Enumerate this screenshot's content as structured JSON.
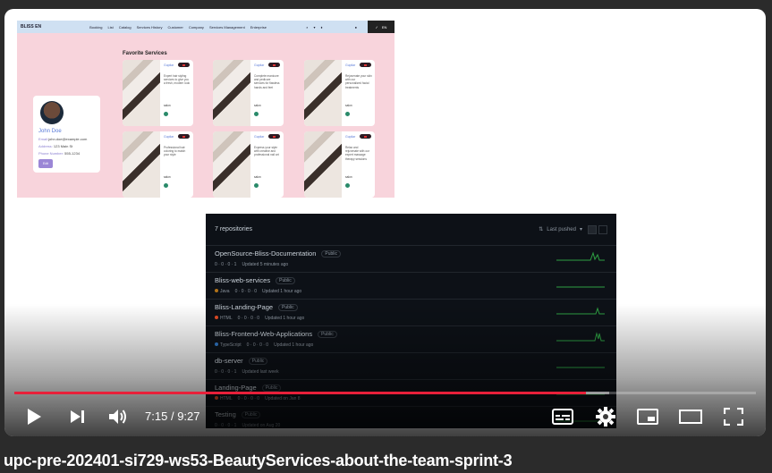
{
  "video": {
    "title": "upc-pre-202401-si729-ws53-BeautyServices-about-the-team-sprint-3",
    "current_time": "7:15",
    "separator": "/",
    "duration": "9:27",
    "progress_fraction": 0.771,
    "buffered_fraction": 0.802,
    "accent_color": "#e8203a"
  },
  "controls": {
    "play": "play-icon",
    "next": "next-icon",
    "volume": "volume-icon",
    "subtitles": "subtitles-icon",
    "settings": "gear-icon",
    "miniplayer": "miniplayer-icon",
    "theater": "theater-icon",
    "fullscreen": "fullscreen-icon"
  },
  "site": {
    "brand": "BLISS EN",
    "nav": [
      "Booking",
      "List",
      "Catalog",
      "Services History",
      "Customer",
      "Company",
      "Services Management",
      "Enterprise"
    ],
    "lang": "EN",
    "profile": {
      "name": "John Doe",
      "email_label": "Email:",
      "email": "john.doe@example.com",
      "address_label": "Address:",
      "address": "123 Main St",
      "phone_label": "Phone Number:",
      "phone": "555-1234",
      "edit": "Edit"
    },
    "favorites_title": "Favorite Services",
    "cards": [
      {
        "tag": "Gupilar",
        "text": "Expert hair styling services to give you a fresh, modern look",
        "save": "salon"
      },
      {
        "tag": "Gupilar",
        "text": "Complete manicure and pedicure services for flawless hands and feet",
        "save": "salon"
      },
      {
        "tag": "Gupilar",
        "text": "Rejuvenate your skin with our personalized facial treatments",
        "save": "salon"
      },
      {
        "tag": "Gupilar",
        "text": "Professional hair coloring to match your style",
        "save": "salon"
      },
      {
        "tag": "Gupilar",
        "text": "Express your style with creative and professional nail art",
        "save": "salon"
      },
      {
        "tag": "Gupilar",
        "text": "Relax and rejuvenate with our expert massage therapy sessions",
        "save": "salon"
      }
    ]
  },
  "repos": {
    "count_label": "7 repositories",
    "sort_label": "Last pushed",
    "items": [
      {
        "name": "OpenSource-Bliss-Documentation",
        "visibility": "Public",
        "lang": "",
        "lang_color": "",
        "stats": "0 · 0 · 0 · 1",
        "updated": "Updated 5 minutes ago"
      },
      {
        "name": "Bliss-web-services",
        "visibility": "Public",
        "lang": "Java",
        "lang_color": "#b07219",
        "stats": "0 · 0 · 0 · 0",
        "updated": "Updated 1 hour ago"
      },
      {
        "name": "Bliss-Landing-Page",
        "visibility": "Public",
        "lang": "HTML",
        "lang_color": "#e34c26",
        "stats": "0 · 0 · 0 · 0",
        "updated": "Updated 1 hour ago"
      },
      {
        "name": "Bliss-Frontend-Web-Applications",
        "visibility": "Public",
        "lang": "TypeScript",
        "lang_color": "#3178c6",
        "stats": "0 · 0 · 0 · 0",
        "updated": "Updated 1 hour ago"
      },
      {
        "name": "db-server",
        "visibility": "Public",
        "lang": "",
        "lang_color": "",
        "stats": "0 · 0 · 0 · 1",
        "updated": "Updated last week"
      },
      {
        "name": "Landing-Page",
        "visibility": "Public",
        "lang": "HTML",
        "lang_color": "#e34c26",
        "stats": "0 · 0 · 0 · 0",
        "updated": "Updated on Jan 8"
      },
      {
        "name": "Testing",
        "visibility": "Public",
        "lang": "",
        "lang_color": "",
        "stats": "0 · 0 · 0 · 1",
        "updated": "Updated on Aug 20"
      }
    ]
  }
}
